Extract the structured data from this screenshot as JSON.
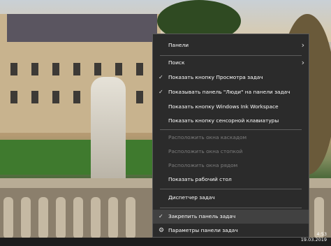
{
  "menu": {
    "items": [
      {
        "label": "Панели",
        "submenu": true
      },
      {
        "label": "Поиск",
        "submenu": true
      },
      {
        "label": "Показать кнопку Просмотра задач",
        "checked": true
      },
      {
        "label": "Показывать панель \"Люди\" на панели задач",
        "checked": true
      },
      {
        "label": "Показать кнопку Windows Ink Workspace"
      },
      {
        "label": "Показать кнопку сенсорной клавиатуры"
      },
      {
        "label": "Расположить окна каскадом",
        "disabled": true
      },
      {
        "label": "Расположить окна стопкой",
        "disabled": true
      },
      {
        "label": "Расположить окна рядом",
        "disabled": true
      },
      {
        "label": "Показать рабочий стол"
      },
      {
        "label": "Диспетчер задач"
      },
      {
        "label": "Закрепить панель задач",
        "checked": true,
        "hovered": true
      },
      {
        "label": "Параметры панели задач",
        "icon": "gear-icon"
      }
    ]
  },
  "clock": {
    "time": "4:53",
    "date": "19.03.2019"
  },
  "icons": {
    "chevron": "chevron-right-icon",
    "check": "checkmark-icon",
    "gear": "gear-icon"
  }
}
